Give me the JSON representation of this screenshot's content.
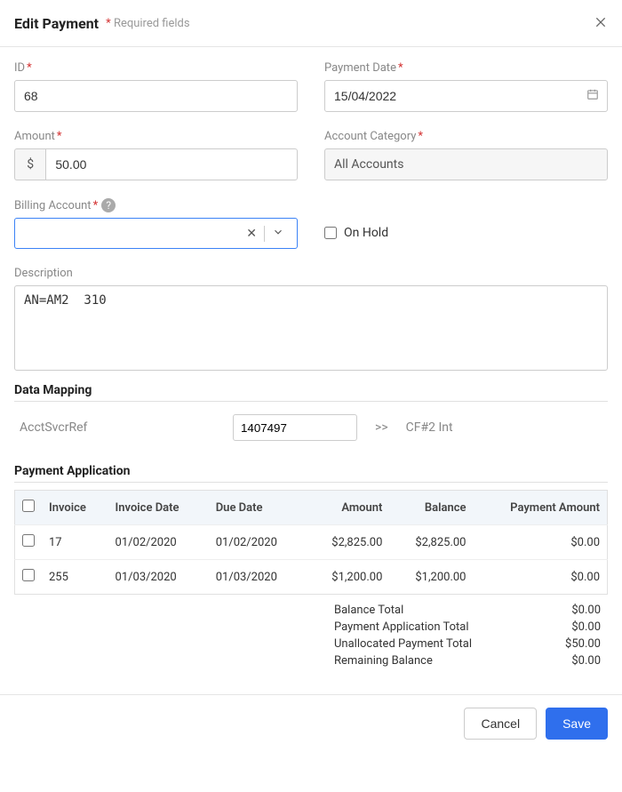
{
  "header": {
    "title": "Edit Payment",
    "required_hint": "Required fields"
  },
  "labels": {
    "id": "ID",
    "payment_date": "Payment Date",
    "amount": "Amount",
    "account_category": "Account Category",
    "billing_account": "Billing Account",
    "on_hold": "On Hold",
    "description": "Description",
    "data_mapping": "Data Mapping",
    "payment_application": "Payment Application"
  },
  "values": {
    "id": "68",
    "payment_date": "15/04/2022",
    "amount": "50.00",
    "currency_symbol": "$",
    "account_category": "All Accounts",
    "billing_account": "",
    "on_hold": false,
    "description": "AN=AM2  310"
  },
  "data_mapping": {
    "source_label": "AcctSvcrRef",
    "source_value": "1407497",
    "arrow": ">>",
    "target": "CF#2 Int"
  },
  "table": {
    "headers": {
      "invoice": "Invoice",
      "invoice_date": "Invoice Date",
      "due_date": "Due Date",
      "amount": "Amount",
      "balance": "Balance",
      "payment_amount": "Payment Amount"
    },
    "rows": [
      {
        "invoice": "17",
        "invoice_date": "01/02/2020",
        "due_date": "01/02/2020",
        "amount": "$2,825.00",
        "balance": "$2,825.00",
        "payment_amount": "$0.00"
      },
      {
        "invoice": "255",
        "invoice_date": "01/03/2020",
        "due_date": "01/03/2020",
        "amount": "$1,200.00",
        "balance": "$1,200.00",
        "payment_amount": "$0.00"
      }
    ]
  },
  "totals": {
    "balance_total": {
      "label": "Balance Total",
      "value": "$0.00"
    },
    "payment_app_total": {
      "label": "Payment Application Total",
      "value": "$0.00"
    },
    "unallocated_total": {
      "label": "Unallocated Payment Total",
      "value": "$50.00"
    },
    "remaining_balance": {
      "label": "Remaining Balance",
      "value": "$0.00"
    }
  },
  "footer": {
    "cancel": "Cancel",
    "save": "Save"
  }
}
